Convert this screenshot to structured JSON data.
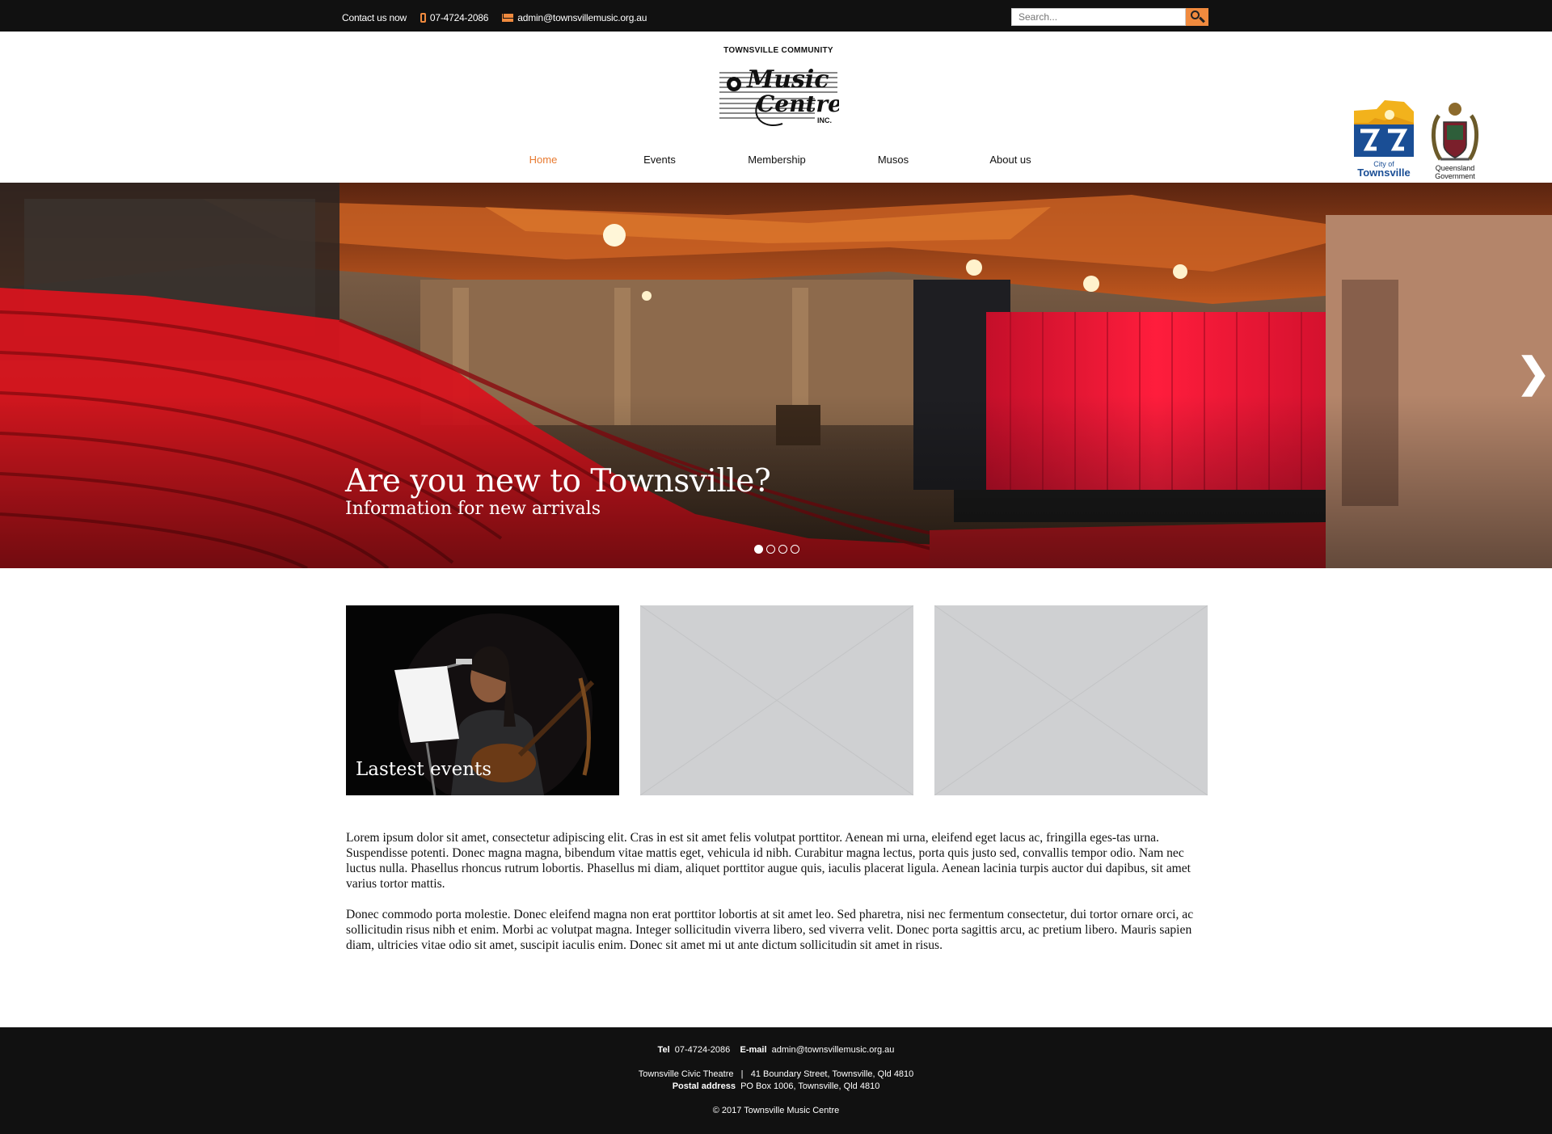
{
  "topbar": {
    "contact_label": "Contact us now",
    "phone": "07-4724-2086",
    "email": "admin@townsvillemusic.org.au",
    "search_placeholder": "Search..."
  },
  "logo": {
    "line1": "TOWNSVILLE COMMUNITY",
    "word1": "Music",
    "word2": "Centre",
    "suffix": "INC."
  },
  "nav": {
    "items": [
      {
        "label": "Home",
        "active": true
      },
      {
        "label": "Events"
      },
      {
        "label": "Membership"
      },
      {
        "label": "Musos"
      },
      {
        "label": "About us"
      }
    ]
  },
  "sponsors": {
    "city_line1": "City of",
    "city_line2": "Townsville",
    "gov_line1": "Queensland",
    "gov_line2": "Government"
  },
  "hero": {
    "title": "Are you new to Townsville?",
    "subtitle": "Information for new arrivals",
    "next_glyph": "❯",
    "slides": 4,
    "active_slide": 1
  },
  "cards": [
    {
      "caption": "Lastest events"
    },
    {
      "caption": ""
    },
    {
      "caption": ""
    }
  ],
  "body": {
    "p1": "Lorem ipsum dolor sit amet, consectetur adipiscing elit. Cras in est sit amet felis volutpat porttitor. Aenean mi urna, eleifend eget lacus ac, fringilla eges-tas urna. Suspendisse potenti. Donec magna magna, bibendum vitae mattis eget, vehicula id nibh. Curabitur magna lectus, porta quis justo sed, convallis tempor odio. Nam nec luctus nulla. Phasellus rhoncus rutrum lobortis. Phasellus mi diam, aliquet porttitor augue quis, iaculis placerat ligula. Aenean lacinia turpis auctor dui dapibus, sit amet varius tortor mattis.",
    "p2": "Donec commodo porta molestie. Donec eleifend magna non erat porttitor lobortis at sit amet leo. Sed pharetra, nisi nec fermentum consectetur, dui tortor ornare orci, ac sollicitudin risus nibh et enim. Morbi ac volutpat magna. Integer sollicitudin viverra libero, sed viverra velit. Donec porta sagittis arcu, ac pretium libero. Mauris sapien diam, ultricies vitae odio sit amet, suscipit iaculis enim. Donec sit amet mi ut ante dictum sollicitudin sit amet in risus."
  },
  "footer": {
    "tel_label": "Tel",
    "tel": "07-4724-2086",
    "email_label": "E-mail",
    "email": "admin@townsvillemusic.org.au",
    "venue": "Townsville Civic Theatre",
    "separator": "|",
    "address": "41 Boundary Street, Townsville, Qld 4810",
    "postal_label": "Postal address",
    "postal": "PO Box 1006, Townsville, Qld 4810",
    "copyright": "© 2017 Townsville Music Centre"
  },
  "colors": {
    "accent": "#e87a30",
    "search_button": "#f08a3e",
    "dark_bar": "#111111",
    "placeholder_card": "#cfd0d2"
  }
}
